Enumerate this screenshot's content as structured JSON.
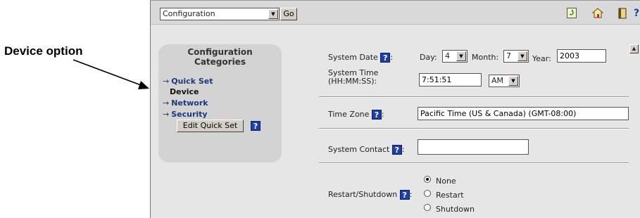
{
  "callout": {
    "label": "Device option"
  },
  "toolbar": {
    "select_value": "Configuration",
    "go_label": "Go",
    "icons": [
      "refresh-icon",
      "home-icon",
      "book-icon",
      "help-icon"
    ],
    "help_glyph": "?"
  },
  "sidebar": {
    "heading_line1": "Configuration",
    "heading_line2": "Categories",
    "items": [
      {
        "label": "Quick Set"
      },
      {
        "label": "Device"
      },
      {
        "label": "Network"
      },
      {
        "label": "Security"
      }
    ],
    "edit_button": "Edit Quick Set",
    "arrow_glyph": "→",
    "help_glyph": "?"
  },
  "form": {
    "system_date_label": "System Date",
    "day_label": "Day:",
    "day_value": "4",
    "month_label": "Month:",
    "month_value": "7",
    "year_label": "Year:",
    "year_value": "2003",
    "system_time_label_line1": "System Time",
    "system_time_label_line2": "(HH:MM:SS):",
    "time_value": "7:51:51",
    "ampm_value": "AM",
    "time_zone_label": "Time Zone",
    "time_zone_value": "Pacific Time (US & Canada) (GMT-08:00)",
    "system_contact_label": "System Contact",
    "system_contact_value": "",
    "restart_label": "Restart/Shutdown",
    "options": [
      {
        "label": "None",
        "selected": true
      },
      {
        "label": "Restart",
        "selected": false
      },
      {
        "label": "Shutdown",
        "selected": false
      }
    ],
    "help_glyph": "?",
    "colon": ":"
  },
  "colors": {
    "help_blue": "#1f3fa6",
    "panel_gray": "#d3d3d3",
    "link_blue": "#1a3a7a"
  }
}
